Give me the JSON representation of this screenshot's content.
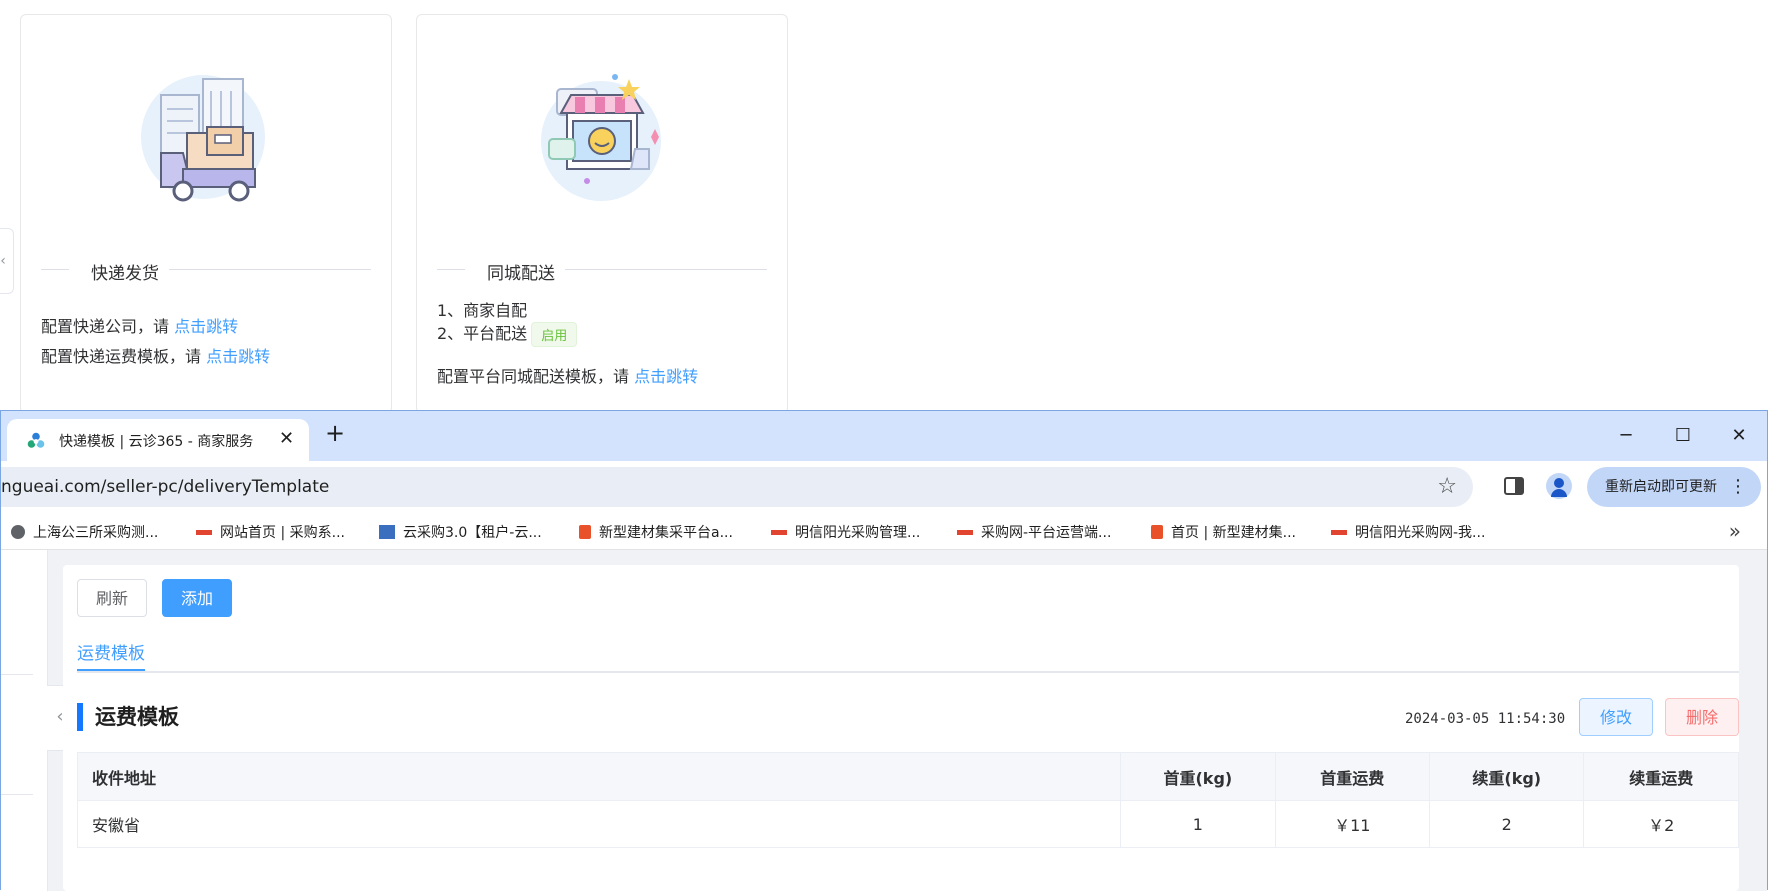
{
  "express_card": {
    "title": "快递发货",
    "line1_text": "配置快递公司，请 ",
    "line1_link": "点击跳转",
    "line2_text": "配置快递运费模板，请 ",
    "line2_link": "点击跳转"
  },
  "city_card": {
    "title": "同城配送",
    "item1": "1、商家自配",
    "item2": "2、平台配送",
    "item2_badge": "启用",
    "line3_text": "配置平台同城配送模板，请 ",
    "line3_link": "点击跳转"
  },
  "browser": {
    "tab_title": "快递模板 | 云诊365 - 商家服务",
    "url": "ngueai.com/seller-pc/deliveryTemplate",
    "update_button": "重新启动即可更新",
    "bookmarks": [
      "上海公三所采购测...",
      "网站首页 | 采购系...",
      "云采购3.0【租户-云...",
      "新型建材集采平台a...",
      "明信阳光采购管理...",
      "采购网-平台运营端...",
      "首页 | 新型建材集...",
      "明信阳光采购网-我..."
    ],
    "icons": {
      "star": "star-icon",
      "sidepanel": "side-panel-icon",
      "profile": "profile-icon",
      "menu": "more-vert-icon"
    }
  },
  "toolbar": {
    "refresh_label": "刷新",
    "add_label": "添加"
  },
  "tabs": [
    "运费模板"
  ],
  "template": {
    "section_title": "运费模板",
    "updated_at": "2024-03-05 11:54:30",
    "edit_label": "修改",
    "delete_label": "删除",
    "columns": [
      "收件地址",
      "首重(kg)",
      "首重运费",
      "续重(kg)",
      "续重运费"
    ],
    "rows": [
      [
        "安徽省",
        "1",
        "￥11",
        "2",
        "￥2"
      ]
    ]
  },
  "colors": {
    "primary": "#409eff",
    "success": "#67c23a",
    "danger": "#f56c6c",
    "titlebar": "#d3e3fd"
  }
}
